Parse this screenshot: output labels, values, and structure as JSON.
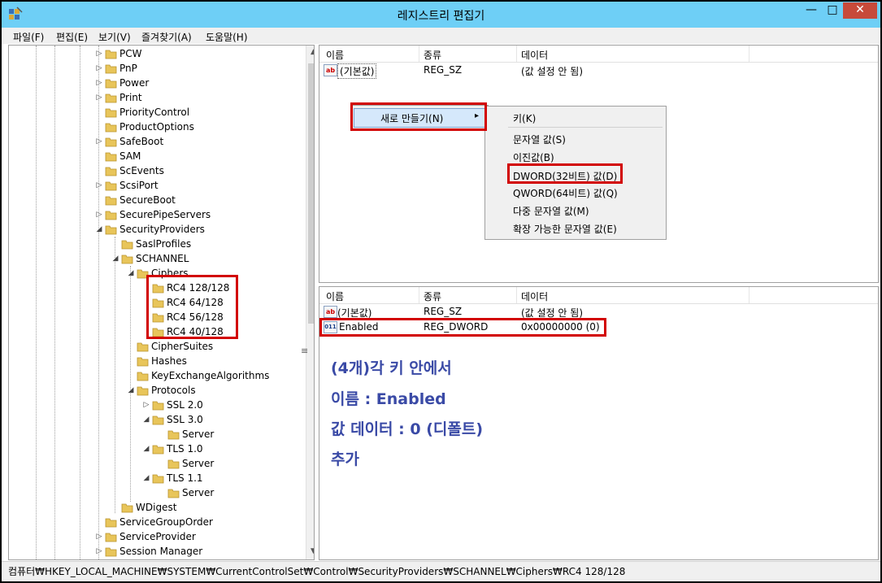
{
  "window": {
    "title": "레지스트리 편집기",
    "min_glyph": "—",
    "max_glyph": "□",
    "close_glyph": "✕"
  },
  "menu": [
    "파일(F)",
    "편집(E)",
    "보기(V)",
    "즐겨찾기(A)",
    "도움말(H)"
  ],
  "tree": {
    "nodes": [
      {
        "label": "PCW",
        "exp": "▷"
      },
      {
        "label": "PnP",
        "exp": "▷"
      },
      {
        "label": "Power",
        "exp": "▷"
      },
      {
        "label": "Print",
        "exp": "▷"
      },
      {
        "label": "PriorityControl",
        "exp": ""
      },
      {
        "label": "ProductOptions",
        "exp": ""
      },
      {
        "label": "SafeBoot",
        "exp": "▷"
      },
      {
        "label": "SAM",
        "exp": ""
      },
      {
        "label": "ScEvents",
        "exp": ""
      },
      {
        "label": "ScsiPort",
        "exp": "▷"
      },
      {
        "label": "SecureBoot",
        "exp": ""
      },
      {
        "label": "SecurePipeServers",
        "exp": "▷"
      },
      {
        "label": "SecurityProviders",
        "exp": "◢"
      },
      {
        "label": "SaslProfiles",
        "exp": ""
      },
      {
        "label": "SCHANNEL",
        "exp": "◢"
      },
      {
        "label": "Ciphers",
        "exp": "◢"
      },
      {
        "label": "RC4 128/128",
        "exp": ""
      },
      {
        "label": "RC4 64/128",
        "exp": ""
      },
      {
        "label": "RC4 56/128",
        "exp": ""
      },
      {
        "label": "RC4 40/128",
        "exp": ""
      },
      {
        "label": "CipherSuites",
        "exp": ""
      },
      {
        "label": "Hashes",
        "exp": ""
      },
      {
        "label": "KeyExchangeAlgorithms",
        "exp": ""
      },
      {
        "label": "Protocols",
        "exp": "◢"
      },
      {
        "label": "SSL 2.0",
        "exp": "▷"
      },
      {
        "label": "SSL 3.0",
        "exp": "◢"
      },
      {
        "label": "Server",
        "exp": ""
      },
      {
        "label": "TLS 1.0",
        "exp": "◢"
      },
      {
        "label": "Server",
        "exp": ""
      },
      {
        "label": "TLS 1.1",
        "exp": "◢"
      },
      {
        "label": "Server",
        "exp": ""
      },
      {
        "label": "WDigest",
        "exp": ""
      },
      {
        "label": "ServiceGroupOrder",
        "exp": ""
      },
      {
        "label": "ServiceProvider",
        "exp": "▷"
      },
      {
        "label": "Session Manager",
        "exp": "▷"
      }
    ]
  },
  "scrollbar": {
    "up": "▲",
    "down": "▼",
    "splitter": "≡"
  },
  "top_pane": {
    "columns": [
      "이름",
      "종류",
      "데이터"
    ],
    "rows": [
      {
        "icon": "ab",
        "name": "(기본값)",
        "type": "REG_SZ",
        "data": "(값 설정 안 됨)"
      }
    ]
  },
  "context_menu": {
    "new_item": "새로 만들기(N)",
    "arrow": "▸",
    "submenu": [
      "키(K)",
      "문자열 값(S)",
      "이진값(B)",
      "DWORD(32비트) 값(D)",
      "QWORD(64비트) 값(Q)",
      "다중 문자열 값(M)",
      "확장 가능한 문자열 값(E)"
    ]
  },
  "bottom_pane": {
    "columns": [
      "이름",
      "종류",
      "데이터"
    ],
    "rows": [
      {
        "icon": "ab",
        "name": "(기본값)",
        "type": "REG_SZ",
        "data": "(값 설정 안 됨)"
      },
      {
        "icon": "011",
        "name": "Enabled",
        "type": "REG_DWORD",
        "data": "0x00000000 (0)"
      }
    ]
  },
  "annotation": [
    "(4개)각 키 안에서",
    "이름 : Enabled",
    "값 데이터 : 0 (디폴트)",
    "추가"
  ],
  "status": {
    "path": "컴퓨터₩HKEY_LOCAL_MACHINE₩SYSTEM₩CurrentControlSet₩Control₩SecurityProviders₩SCHANNEL₩Ciphers₩RC4 128/128"
  },
  "colors": {
    "titlebar": "#6ecff6",
    "highlight_box": "#d20000",
    "annotation": "#3a4aa6",
    "folder": "#e8c55a"
  }
}
